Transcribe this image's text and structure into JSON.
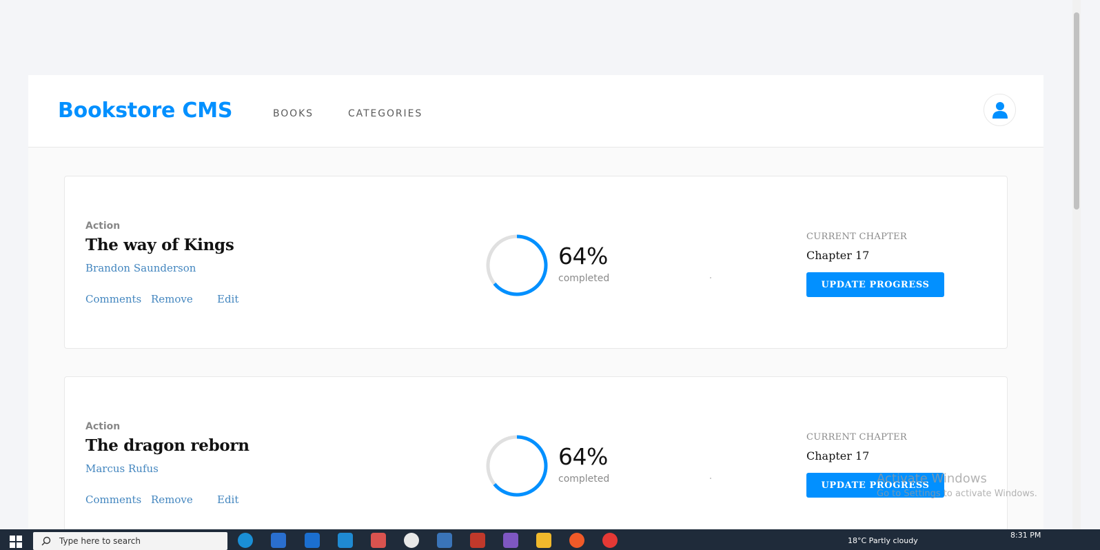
{
  "header": {
    "brand": "Bookstore CMS",
    "nav": [
      {
        "label": "BOOKS"
      },
      {
        "label": "CATEGORIES"
      }
    ]
  },
  "books": [
    {
      "genre": "Action",
      "title": "The way of Kings",
      "author": "Brandon Saunderson",
      "actions": {
        "comments": "Comments",
        "remove": "Remove",
        "edit": "Edit"
      },
      "progress": 64,
      "percent_label": "64%",
      "completed_label": "completed",
      "chapter_label": "CURRENT CHAPTER",
      "chapter": "Chapter 17",
      "update_label": "UPDATE PROGRESS"
    },
    {
      "genre": "Action",
      "title": "The dragon reborn",
      "author": "Marcus Rufus",
      "actions": {
        "comments": "Comments",
        "remove": "Remove",
        "edit": "Edit"
      },
      "progress": 64,
      "percent_label": "64%",
      "completed_label": "completed",
      "chapter_label": "CURRENT CHAPTER",
      "chapter": "Chapter 17",
      "update_label": "UPDATE PROGRESS"
    }
  ],
  "watermark": {
    "title": "Activate Windows",
    "subtitle": "Go to Settings to activate Windows."
  },
  "taskbar": {
    "search_placeholder": "Type here to search",
    "weather": "18°C  Partly cloudy",
    "clock": "8:31 PM"
  },
  "colors": {
    "accent": "#0290ff",
    "link": "#4386bf",
    "ring_track": "#e8e8e8"
  },
  "icons": {
    "avatar": "user-icon",
    "start": "windows-logo-icon",
    "search": "search-icon"
  }
}
